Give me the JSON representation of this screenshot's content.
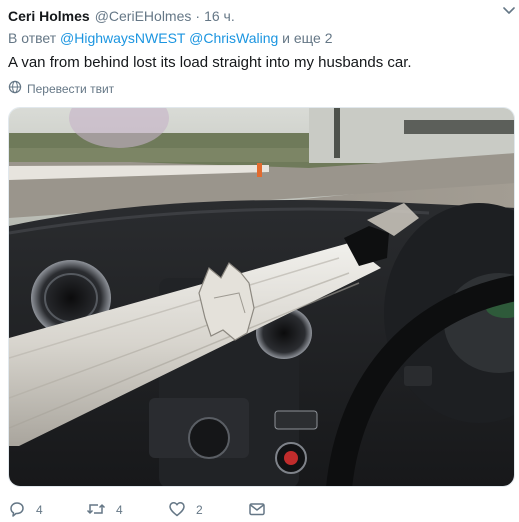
{
  "tweet": {
    "display_name": "Ceri Holmes",
    "handle": "@CeriEHolmes",
    "separator": "·",
    "timestamp": "16 ч.",
    "reply_prefix": "В ответ",
    "reply_mentions": [
      "@HighwaysNWEST",
      "@ChrisWaling"
    ],
    "reply_suffix": "и еще 2",
    "text": "A van from behind lost its load straight into my husbands car.",
    "translate_label": "Перевести твит",
    "counts": {
      "replies": "4",
      "retweets": "4",
      "likes": "2"
    }
  },
  "icons": {
    "caret": "chevron-down-icon",
    "translate": "globe-icon",
    "reply": "reply-icon",
    "retweet": "retweet-icon",
    "like": "heart-icon",
    "message": "envelope-icon"
  },
  "colors": {
    "text": "#14171a",
    "secondary": "#657786",
    "link": "#1b95e0",
    "border": "#e1e8ed"
  }
}
